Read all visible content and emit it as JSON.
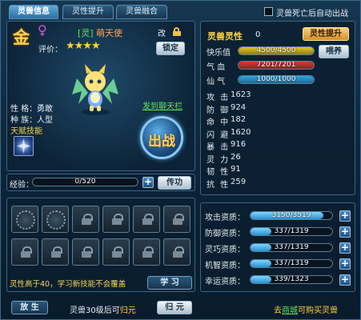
{
  "tabs": [
    {
      "label": "灵兽信息"
    },
    {
      "label": "灵性提升"
    },
    {
      "label": "灵兽融合"
    }
  ],
  "auto_battle_label": "灵兽死亡后自动出战",
  "pet": {
    "grade": "金",
    "gender_symbol": "♀",
    "title_prefix": "[灵]",
    "name": "萌天使",
    "rename_label": "改",
    "rating_label": "评价：",
    "stars": "★★★★",
    "lock_label": "锁定",
    "show_link": "发到聊天栏",
    "personality_label": "性 格：",
    "personality": "勇敢",
    "race_label": "种 族：",
    "race": "人型",
    "talent_label": "天赋技能",
    "battle_label": "出战"
  },
  "exp": {
    "label": "经验：",
    "value": "0/520",
    "fraction": 0,
    "pass_label": "传功"
  },
  "skills": {
    "hint": "灵性高于40，学习新技能不会覆盖",
    "learn_label": "学 习"
  },
  "bottom": {
    "release_label": "放 生",
    "info_prefix": "灵兽30级后可",
    "info_link": "归元",
    "return_label": "归 元",
    "shop_prefix": "去",
    "shop_link": "商城",
    "shop_suffix": "可购买灵兽"
  },
  "spirit": {
    "label": "灵兽灵性",
    "value": "0",
    "upgrade_label": "灵性提升"
  },
  "bars": [
    {
      "label": "快乐值",
      "text": "4500/4500",
      "fraction": 1.0,
      "color": "#e7c61e"
    },
    {
      "label": "气 血",
      "text": "7201/7201",
      "fraction": 1.0,
      "color": "#d83a2c"
    },
    {
      "label": "仙 气",
      "text": "1000/1000",
      "fraction": 1.0,
      "color": "#2fa3e0"
    }
  ],
  "feed_label": "喂养",
  "stats": [
    {
      "label": "攻 击",
      "value": "1623"
    },
    {
      "label": "防 御",
      "value": "924"
    },
    {
      "label": "命 中",
      "value": "182"
    },
    {
      "label": "闪 避",
      "value": "1620"
    },
    {
      "label": "暴 击",
      "value": "916"
    },
    {
      "label": "灵 力",
      "value": "26"
    },
    {
      "label": "韧 性",
      "value": "91"
    },
    {
      "label": "抗 性",
      "value": "259"
    }
  ],
  "aptitudes": [
    {
      "label": "攻击资质：",
      "text": "3150/3519",
      "fraction": 0.895
    },
    {
      "label": "防御资质：",
      "text": "337/1319",
      "fraction": 0.255
    },
    {
      "label": "灵巧资质：",
      "text": "337/1319",
      "fraction": 0.255
    },
    {
      "label": "机智资质：",
      "text": "337/1319",
      "fraction": 0.255
    },
    {
      "label": "幸运资质：",
      "text": "339/1323",
      "fraction": 0.256
    }
  ]
}
